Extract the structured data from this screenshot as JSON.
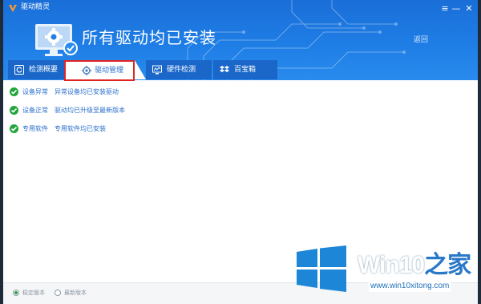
{
  "app": {
    "title": "驱动精灵"
  },
  "window_controls": {
    "menu": "≡",
    "minimize": "—",
    "close": "✕"
  },
  "hero": {
    "title": "所有驱动均已安装",
    "back_link": "返回"
  },
  "tabs": [
    {
      "label": "检测概要",
      "icon": "refresh-icon"
    },
    {
      "label": "驱动管理",
      "icon": "gear-icon"
    },
    {
      "label": "硬件检测",
      "icon": "monitor-chart-icon"
    },
    {
      "label": "百宝箱",
      "icon": "dropbox-icon"
    }
  ],
  "status_rows": [
    {
      "category": "设备异常",
      "description": "异常设备均已安装驱动"
    },
    {
      "category": "设备正常",
      "description": "驱动均已升级至最新版本"
    },
    {
      "category": "专用软件",
      "description": "专用软件均已安装"
    }
  ],
  "footer": {
    "options": [
      {
        "label": "稳定版本",
        "selected": true
      },
      {
        "label": "最新版本",
        "selected": false
      }
    ]
  },
  "watermark": {
    "brand_a": "Win10",
    "brand_b": "之家",
    "url": "www.win10xitong.com"
  },
  "colors": {
    "header_blue": "#1f7fe6",
    "accent_blue": "#2a6fcc",
    "check_green": "#22a53a",
    "highlight_red": "#e02424"
  }
}
